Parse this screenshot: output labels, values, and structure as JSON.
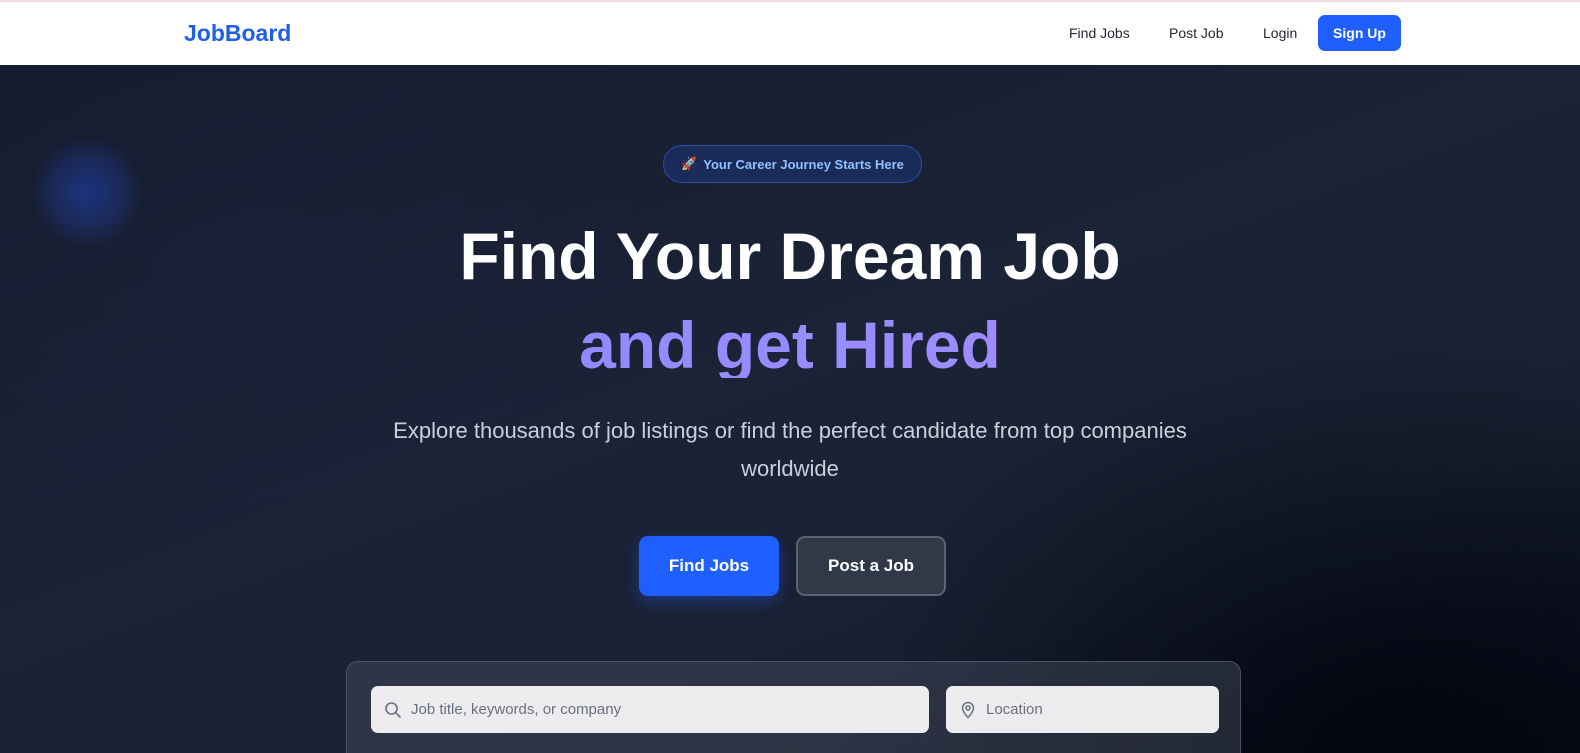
{
  "navbar": {
    "logo": "JobBoard",
    "links": {
      "find_jobs": "Find Jobs",
      "post_job": "Post Job",
      "login": "Login"
    },
    "signup_label": "Sign Up"
  },
  "hero": {
    "badge": {
      "icon": "rocket-icon",
      "emoji": "🚀",
      "text": "Your Career Journey Starts Here"
    },
    "headline_line1": "Find Your Dream Job",
    "headline_line2": "and get Hired",
    "subtext": "Explore thousands of job listings or find the perfect candidate from top companies worldwide",
    "primary_cta": "Find Jobs",
    "secondary_cta": "Post a Job"
  },
  "search": {
    "keyword": {
      "icon": "search-icon",
      "placeholder": "Job title, keywords, or company",
      "value": ""
    },
    "location": {
      "icon": "location-pin-icon",
      "placeholder": "Location",
      "value": ""
    }
  },
  "colors": {
    "brand": "#1f5fe8",
    "primary_button": "#1f5fff",
    "badge_text": "#8fc0ff",
    "hero_bg": "#1b2336"
  }
}
